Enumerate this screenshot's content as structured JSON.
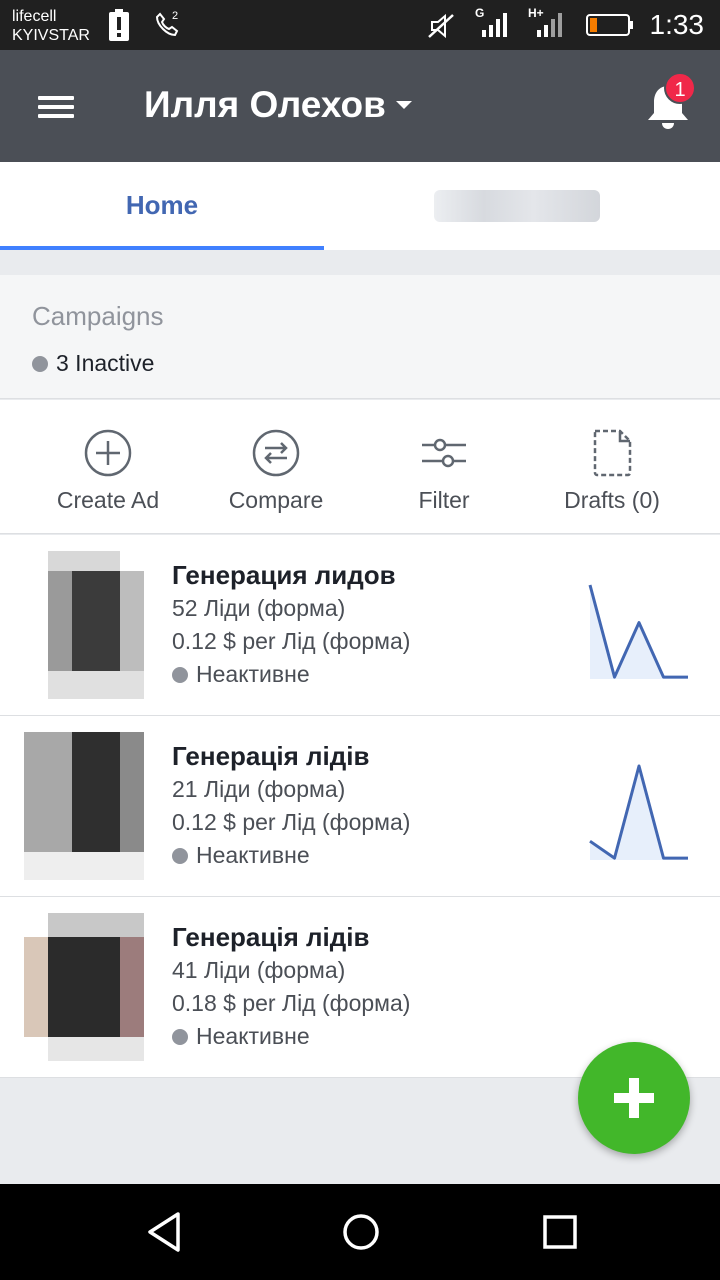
{
  "status_bar": {
    "carrier_line1": "lifecell",
    "carrier_line2": "KYIVSTAR",
    "time": "1:33",
    "call_sim": "2",
    "network_1": "G",
    "network_2": "H+",
    "icons": [
      "battery-alert-icon",
      "phone-call-icon",
      "silent-icon",
      "signal-icon",
      "battery-icon"
    ]
  },
  "app_bar": {
    "account_name": "Илля Олехов",
    "notification_count": "1",
    "icons": [
      "menu-icon",
      "chevron-down-icon",
      "bell-icon"
    ]
  },
  "tabs": {
    "home": "Home"
  },
  "campaigns": {
    "title": "Campaigns",
    "status": "3 Inactive"
  },
  "actions": [
    {
      "label": "Create Ad",
      "icon": "plus-circle-icon"
    },
    {
      "label": "Compare",
      "icon": "swap-circle-icon"
    },
    {
      "label": "Filter",
      "icon": "sliders-icon"
    },
    {
      "label": "Drafts (0)",
      "icon": "document-icon"
    }
  ],
  "campaign_items": [
    {
      "title": "Генерация лидов",
      "results": "52 Ліди (форма)",
      "cost": "0.12 $ per Лід (форма)",
      "status": "Неактивне",
      "trend": [
        100,
        2,
        60,
        2,
        2
      ]
    },
    {
      "title": "Генерація лідів",
      "results": "21 Ліди (форма)",
      "cost": "0.12 $ per Лід (форма)",
      "status": "Неактивне",
      "trend": [
        20,
        2,
        100,
        2,
        2
      ]
    },
    {
      "title": "Генерація лідів",
      "results": "41 Ліди (форма)",
      "cost": "0.18 $ per Лід (форма)",
      "status": "Неактивне"
    }
  ],
  "colors": {
    "app_bar": "#4b4f56",
    "accent": "#4267b2",
    "fab": "#42b72a",
    "badge": "#f02849",
    "chart_line": "#4267b2",
    "chart_fill": "#e7effb"
  }
}
